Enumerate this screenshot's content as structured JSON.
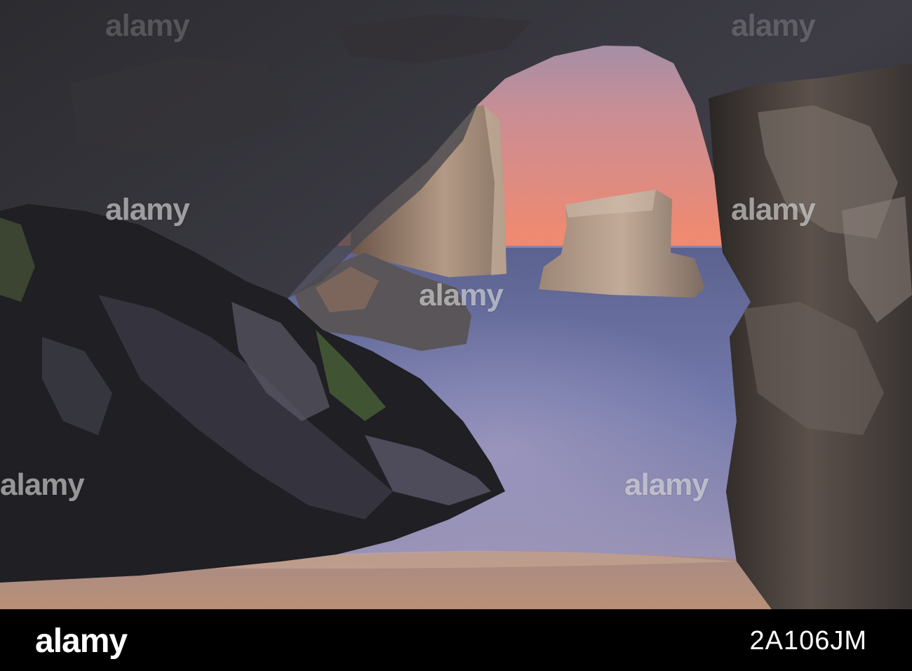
{
  "watermark": {
    "text": "alamy"
  },
  "footer": {
    "logo": "alamy",
    "image_id": "2A106JM"
  },
  "colors": {
    "sky_top": "#8a8ea8",
    "sky_bottom": "#f08a70",
    "sea": "#6d74a6",
    "sand": "#b59077",
    "rock_dark": "#1a1a1c"
  }
}
